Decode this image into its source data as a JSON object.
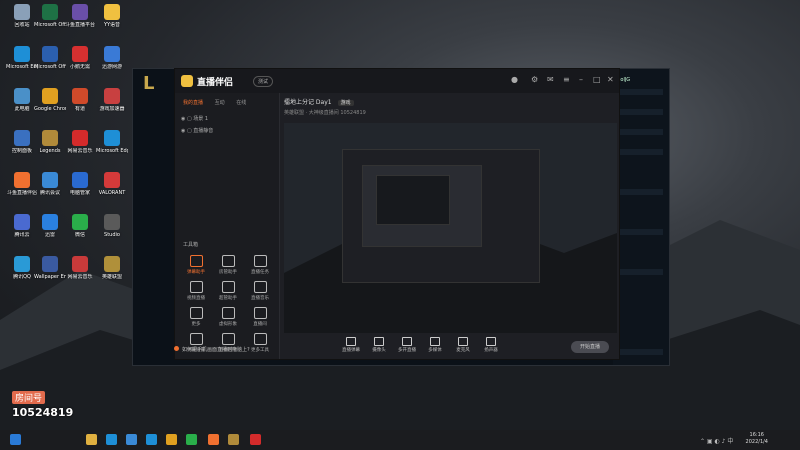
{
  "desktop": {
    "icons": [
      {
        "label": "回收站",
        "color": "#8aa0b8"
      },
      {
        "label": "Microsoft Office Exc...",
        "color": "#1e7145"
      },
      {
        "label": "斗鱼直播平台",
        "color": "#6a4fa8"
      },
      {
        "label": "YY语音",
        "color": "#f0c040"
      },
      {
        "label": "Microsoft Edge",
        "color": "#1e8fd6"
      },
      {
        "label": "Microsoft Office Wo...",
        "color": "#2b5fae"
      },
      {
        "label": "小鹅无需",
        "color": "#d63030"
      },
      {
        "label": "迅游网游",
        "color": "#3a7ad6"
      },
      {
        "label": "此电脑",
        "color": "#4a90c8"
      },
      {
        "label": "Google Chrome",
        "color": "#e0a020"
      },
      {
        "label": "有道",
        "color": "#d04a2a"
      },
      {
        "label": "游戏加速器",
        "color": "#c84040"
      },
      {
        "label": "控制面板",
        "color": "#3a70c0"
      },
      {
        "label": "Legends",
        "color": "#b08a3a"
      },
      {
        "label": "网易云音乐",
        "color": "#d42b2b"
      },
      {
        "label": "Microsoft Edge",
        "color": "#1e8fd6"
      },
      {
        "label": "斗鱼直播伴侣",
        "color": "#f07030"
      },
      {
        "label": "腾讯会议",
        "color": "#3a8ad6"
      },
      {
        "label": "电脑管家",
        "color": "#2a6ad0"
      },
      {
        "label": "VALORANT",
        "color": "#d43a3a"
      },
      {
        "label": "腾讯云",
        "color": "#4a6ad0"
      },
      {
        "label": "迅雷",
        "color": "#2a80e0"
      },
      {
        "label": "微信",
        "color": "#2aae4a"
      },
      {
        "label": "Studio",
        "color": "#5a5a5a"
      },
      {
        "label": "腾讯QQ",
        "color": "#2a9ad6"
      },
      {
        "label": "Wallpaper Engine",
        "color": "#3a5aa0"
      },
      {
        "label": "网易云音乐",
        "color": "#c83a3a"
      },
      {
        "label": "英雄联盟",
        "color": "#b0903a"
      }
    ],
    "overlay_label": "房间号",
    "overlay_room": "10524819"
  },
  "app": {
    "title": "直播伴侣",
    "badge": "测试",
    "left_tabs": [
      "我的直播",
      "互动",
      "在线"
    ],
    "scenes": [
      "场景 1",
      "直播静音"
    ],
    "tools_label": "工具箱",
    "tools": [
      {
        "label": "弹幕助手",
        "hot": true
      },
      {
        "label": "房管助手",
        "hot": false
      },
      {
        "label": "直播任务",
        "hot": false
      },
      {
        "label": "视频直播",
        "hot": false
      },
      {
        "label": "超管助手",
        "hot": false
      },
      {
        "label": "直播音乐",
        "hot": false
      },
      {
        "label": "更多",
        "hot": false
      },
      {
        "label": "虚拟形象",
        "hot": false
      },
      {
        "label": "直播间",
        "hot": false
      },
      {
        "label": "弹幕设置",
        "hot": false
      },
      {
        "label": "直播回放",
        "hot": false
      },
      {
        "label": "更多工具",
        "hot": false
      }
    ],
    "stream_title": "擂地上分记 Day1",
    "stream_tag": "游戏",
    "stream_meta": "英雄联盟 · 大神级直播间  10524819",
    "controls": [
      "直播弹幕",
      "摄像头",
      "多开直播",
      "多媒体",
      "麦克风",
      "扬声器"
    ],
    "go_live": "开始直播",
    "notice": "如何把手机画面直播到电脑上?"
  },
  "bg_window": {
    "label": "LoL客户端",
    "right_text": "lolJG"
  },
  "taskbar": {
    "time": "16:16",
    "date": "2022/1/4"
  }
}
